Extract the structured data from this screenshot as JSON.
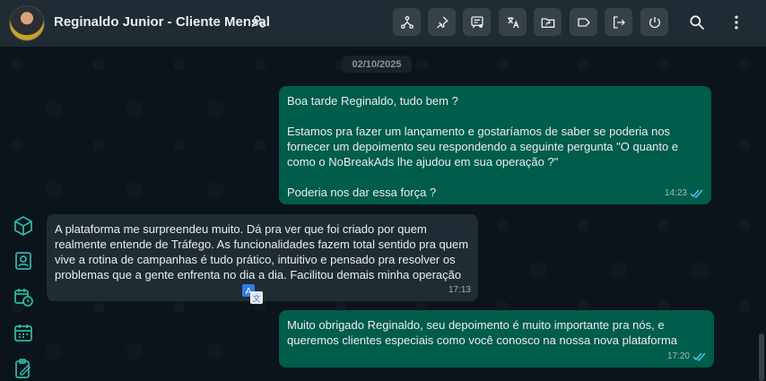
{
  "header": {
    "contact_name": "Reginaldo Junior - Cliente Mensal",
    "toolbar": [
      "tree-icon",
      "pin-icon",
      "message-settings-icon",
      "translate-icon",
      "share-folder-icon",
      "label-icon",
      "logout-icon",
      "power-icon"
    ],
    "search_icon": "search-icon",
    "menu_icon": "more-vert-icon"
  },
  "chat": {
    "date_separator": "02/10/2025",
    "messages": [
      {
        "direction": "out",
        "text": "Boa tarde Reginaldo, tudo bem ?\n\nEstamos pra fazer um lançamento e gostaríamos de saber se poderia nos fornecer um depoimento seu respondendo a seguinte pergunta \"O quanto e como o NoBreakAds lhe ajudou em sua operação ?\"\n\nPoderia nos dar essa força ?",
        "time": "14:23",
        "status": "read"
      },
      {
        "direction": "in",
        "text": "A plataforma me surpreendeu muito. Dá pra ver que foi criado por quem realmente entende de Tráfego. As funcionalidades fazem total sentido pra quem vive a rotina de campanhas é tudo prático, intuitivo e pensado pra resolver os problemas que a gente enfrenta no dia a dia. Facilitou demais minha operação",
        "time": "17:13"
      },
      {
        "direction": "out",
        "text": "Muito obrigado Reginaldo, seu depoimento é muito importante pra nós, e queremos clientes especiais como você conosco na nossa nova plataforma",
        "time": "17:20",
        "status": "read"
      }
    ]
  },
  "side_panel": [
    "box-icon",
    "contact-card-icon",
    "calendar-clock-icon",
    "calendar-icon",
    "clipboard-edit-icon"
  ],
  "colors": {
    "background": "#0b141a",
    "header": "#202c33",
    "outgoing_bubble": "#005c4b",
    "incoming_bubble": "#202c33",
    "accent": "#2fb5a5",
    "read_ticks": "#53bdeb"
  }
}
